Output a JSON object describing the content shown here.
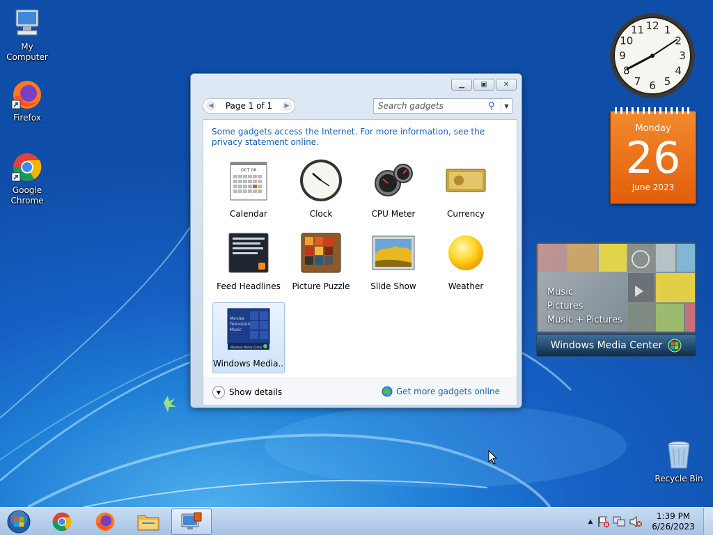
{
  "desktop": {
    "icons": [
      {
        "label": "My Computer"
      },
      {
        "label": "Firefox"
      },
      {
        "label": "Google Chrome"
      },
      {
        "label": "Recycle Bin"
      }
    ]
  },
  "gadget_window": {
    "pager_label": "Page 1 of 1",
    "search_placeholder": "Search gadgets",
    "notice": "Some gadgets access the Internet.  For more information, see the privacy statement online.",
    "gadgets": [
      {
        "label": "Calendar"
      },
      {
        "label": "Clock"
      },
      {
        "label": "CPU Meter"
      },
      {
        "label": "Currency"
      },
      {
        "label": "Feed Headlines"
      },
      {
        "label": "Picture Puzzle"
      },
      {
        "label": "Slide Show"
      },
      {
        "label": "Weather"
      },
      {
        "label": "Windows Media..."
      }
    ],
    "calendar_month": "OCT 06",
    "wmc_thumb_items": [
      "Movies",
      "Television",
      "Music"
    ],
    "wmc_thumb_footer": "Windows Media Center",
    "show_details": "Show details",
    "get_more": "Get more gadgets online"
  },
  "calendar_gadget": {
    "day_name": "Monday",
    "day": "26",
    "month_year": "June 2023"
  },
  "clock_gadget": {
    "numerals": [
      "12",
      "1",
      "2",
      "3",
      "4",
      "5",
      "6",
      "7",
      "8",
      "9",
      "10",
      "11"
    ]
  },
  "wmc_gadget": {
    "menu": [
      "Music",
      "Pictures",
      "Music + Pictures"
    ],
    "bar_label": "Windows Media Center"
  },
  "taskbar": {
    "time": "1:39 PM",
    "date": "6/26/2023"
  },
  "colors": {
    "accent_link": "#1a5fb4",
    "calendar_orange": "#e35e0a",
    "taskbar": "#b8d0ea"
  }
}
